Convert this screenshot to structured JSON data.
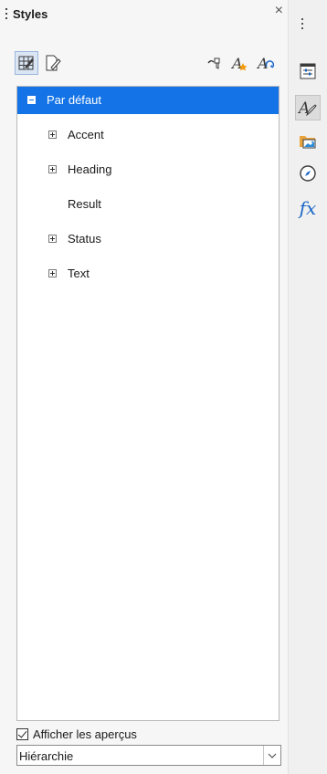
{
  "panel": {
    "title": "Styles",
    "close_icon": "×"
  },
  "toolbar": {
    "buttons": [
      {
        "icon": "cell-styles-icon",
        "active": true
      },
      {
        "icon": "page-styles-icon",
        "active": false
      },
      {
        "icon": "fill-format-mode-icon",
        "active": false
      },
      {
        "icon": "new-style-from-selection-icon",
        "active": false
      },
      {
        "icon": "update-style-icon",
        "active": false
      }
    ]
  },
  "tree": {
    "items": [
      {
        "label": "Par défaut",
        "level": 0,
        "expander": "minus",
        "selected": true
      },
      {
        "label": "Accent",
        "level": 1,
        "expander": "plus",
        "selected": false
      },
      {
        "label": "Heading",
        "level": 1,
        "expander": "plus",
        "selected": false
      },
      {
        "label": "Result",
        "level": 1,
        "expander": "none",
        "selected": false
      },
      {
        "label": "Status",
        "level": 1,
        "expander": "plus",
        "selected": false
      },
      {
        "label": "Text",
        "level": 1,
        "expander": "plus",
        "selected": false
      }
    ]
  },
  "preview": {
    "label": "Afficher les aperçus",
    "checked": true
  },
  "filter": {
    "value": "Hiérarchie"
  },
  "sidebar": {
    "fx_label": "fx",
    "buttons": [
      {
        "icon": "properties-icon",
        "active": false
      },
      {
        "icon": "styles-icon",
        "active": true
      },
      {
        "icon": "gallery-icon",
        "active": false
      },
      {
        "icon": "navigator-icon",
        "active": false
      },
      {
        "icon": "functions-icon",
        "active": false
      }
    ]
  },
  "colors": {
    "selection": "#1473e6",
    "accent_blue": "#1a66c9",
    "gallery_orange": "#e8a33c"
  }
}
